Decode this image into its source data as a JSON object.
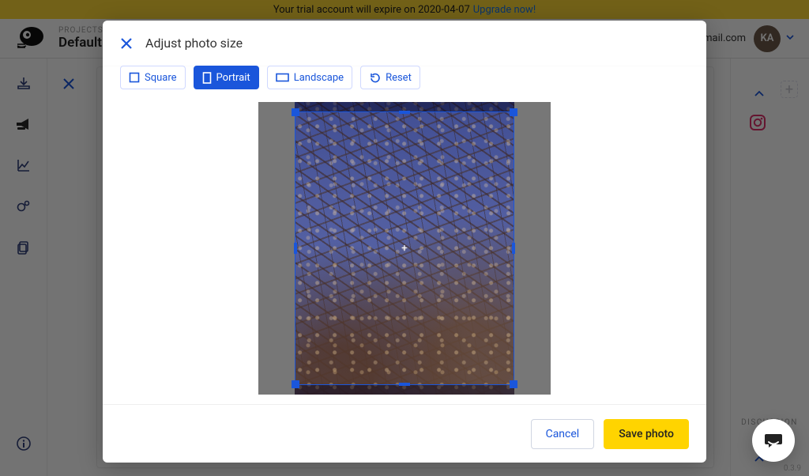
{
  "banner": {
    "text": "Your trial account will expire on 2020-04-07",
    "link": "Upgrade now!"
  },
  "header": {
    "crumb_small": "PROJECTS",
    "crumb_big": "Default p",
    "email_suffix": "gmail.com",
    "avatar_initials": "KA"
  },
  "right_pane": {
    "discussion_label": "DISCUSSION"
  },
  "version": "0.3.9",
  "modal": {
    "title": "Adjust photo size",
    "options": {
      "square": "Square",
      "portrait": "Portrait",
      "landscape": "Landscape",
      "reset": "Reset",
      "active": "portrait"
    },
    "buttons": {
      "cancel": "Cancel",
      "save": "Save photo"
    }
  }
}
